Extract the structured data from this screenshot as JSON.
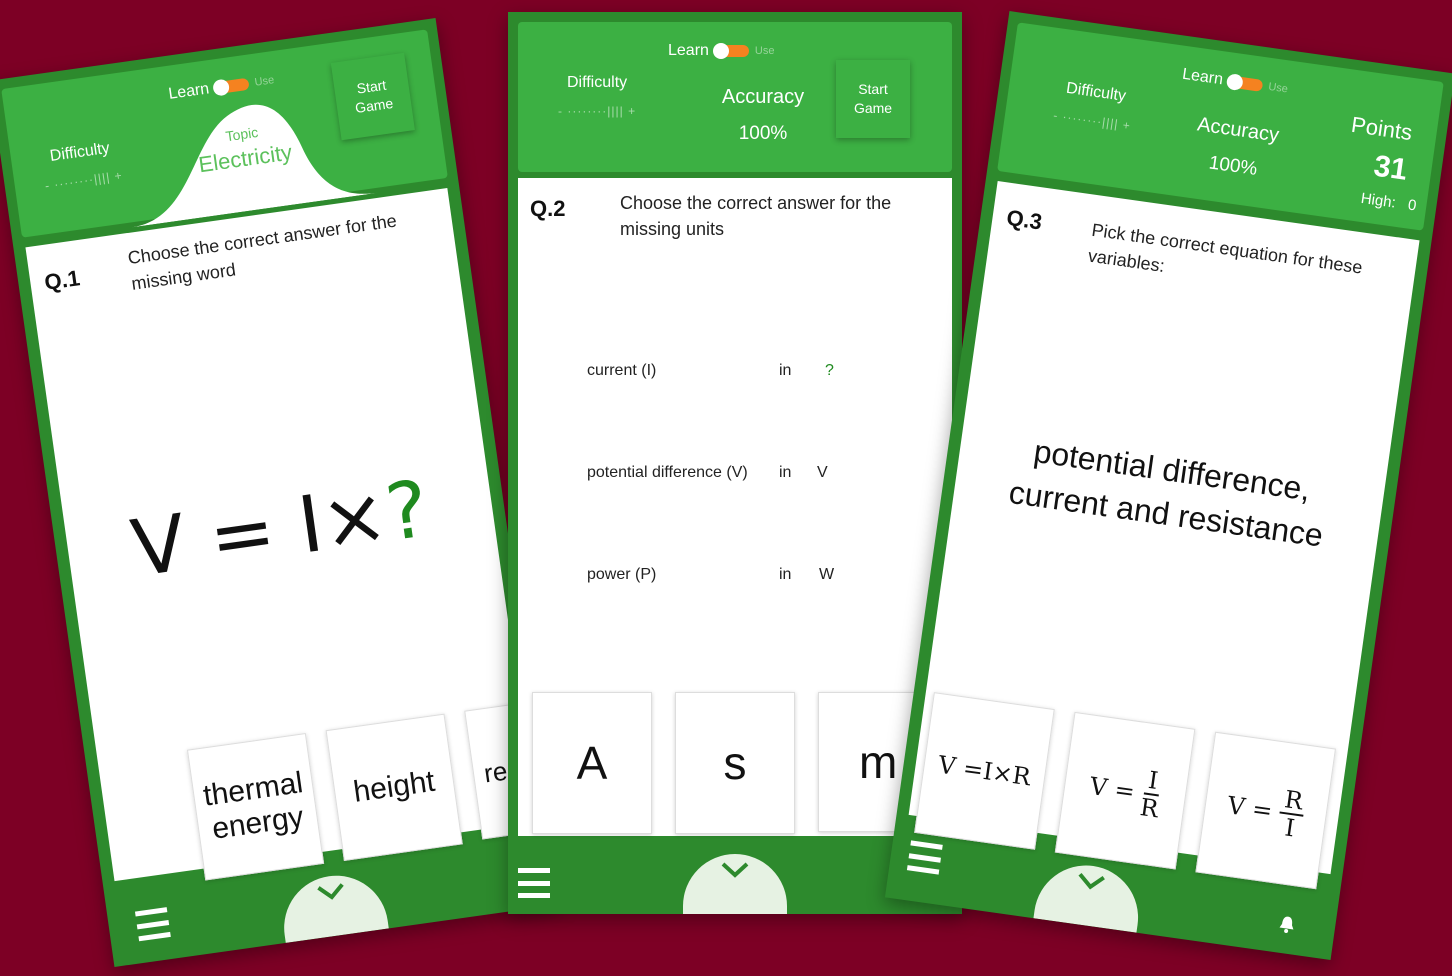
{
  "screens": [
    {
      "learn_label": "Learn",
      "use_label": "Use",
      "difficulty_label": "Difficulty",
      "slider_text": "- ········|||| +",
      "topic_label": "Topic",
      "topic_value": "Electricity",
      "start_label_1": "Start",
      "start_label_2": "Game",
      "question_number": "Q.1",
      "question_line_1": "Choose the correct answer for the",
      "question_line_2": "missing word",
      "equation_lhs": "V = I×",
      "equation_missing": "?",
      "answers": [
        "thermal energy",
        "height",
        "resista"
      ]
    },
    {
      "learn_label": "Learn",
      "use_label": "Use",
      "difficulty_label": "Difficulty",
      "slider_text": "- ········|||| +",
      "accuracy_label": "Accuracy",
      "accuracy_value": "100%",
      "start_label_1": "Start",
      "start_label_2": "Game",
      "question_number": "Q.2",
      "question_line_1": "Choose the correct answer for the",
      "question_line_2": "missing units",
      "rows": [
        {
          "quantity": "current (I)",
          "in": "in",
          "unit": "?"
        },
        {
          "quantity": "potential difference (V)",
          "in": "in",
          "unit": "V"
        },
        {
          "quantity": "power (P)",
          "in": "in",
          "unit": "W"
        }
      ],
      "answers": [
        "A",
        "s",
        "m"
      ]
    },
    {
      "learn_label": "Learn",
      "use_label": "Use",
      "difficulty_label": "Difficulty",
      "slider_text": "- ········|||| +",
      "accuracy_label": "Accuracy",
      "accuracy_value": "100%",
      "points_label": "Points",
      "points_value": "31",
      "high_label": "High:",
      "high_value": "0",
      "question_number": "Q.3",
      "question_line_1": "Pick the correct equation for these",
      "question_line_2": "variables:",
      "variables_line_1": "potential difference,",
      "variables_line_2": "current and resistance",
      "answers": [
        {
          "lhs": "V = ",
          "text": "I×R"
        },
        {
          "lhs": "V = ",
          "num": "I",
          "den": "R"
        },
        {
          "lhs": "V = ",
          "num": "R",
          "den": "I"
        }
      ]
    }
  ],
  "colors": {
    "background": "#7d0025",
    "frame": "#2d8a2d",
    "header": "#3cb043",
    "accent_green": "#1f8a1f",
    "toggle": "#f58220"
  },
  "icons": [
    "toggle-icon",
    "menu-icon",
    "chevron-down-icon",
    "bell-icon"
  ]
}
